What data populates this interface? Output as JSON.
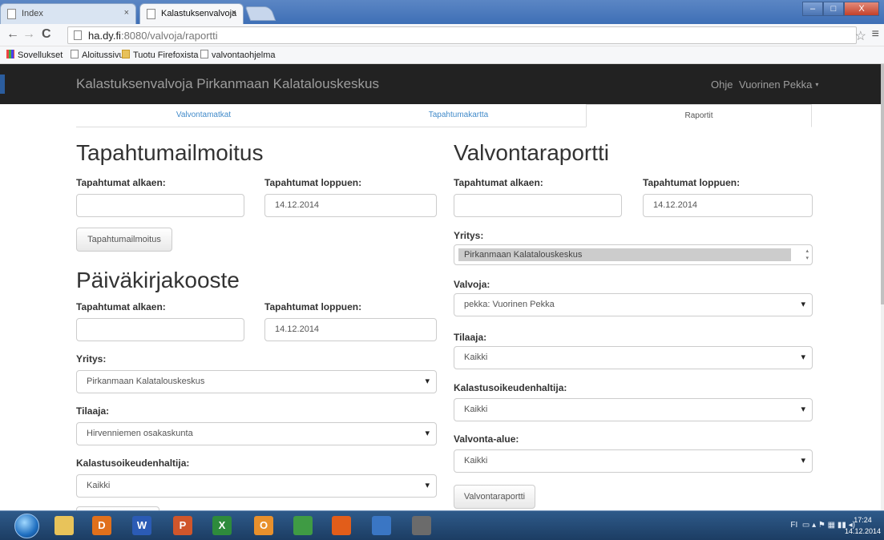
{
  "browser": {
    "tabs": [
      {
        "label": "Index",
        "close": "×"
      },
      {
        "label": "Kalastuksenvalvoja",
        "close": "×"
      }
    ],
    "window_buttons": {
      "minimize": "–",
      "maximize": "□",
      "close": "X"
    },
    "back": "←",
    "forward": "→",
    "reload": "C",
    "url_host": "ha.dy.fi",
    "url_path": ":8080/valvoja/raportti",
    "bookmark_star": "☆",
    "menu": "≡",
    "bookmarks": [
      "Sovellukset",
      "Aloitussivu",
      "Tuotu Firefoxista",
      "valvontaohjelma"
    ]
  },
  "app": {
    "brand": "Kalastuksenvalvoja   Pirkanmaan Kalatalouskeskus",
    "help": "Ohje",
    "user": "Vuorinen Pekka",
    "user_caret": "▾",
    "tabs": [
      "Valvontamatkat",
      "Tapahtumakartta",
      "Raportit"
    ],
    "active_tab": "Raportit"
  },
  "tapahtumailmoitus": {
    "title": "Tapahtumailmoitus",
    "start_label": "Tapahtumat alkaen:",
    "start_value": "",
    "end_label": "Tapahtumat loppuen:",
    "end_value": "14.12.2014",
    "button": "Tapahtumailmoitus"
  },
  "paivakirjakooste": {
    "title": "Päiväkirjakooste",
    "start_label": "Tapahtumat alkaen:",
    "start_value": "",
    "end_label": "Tapahtumat loppuen:",
    "end_value": "14.12.2014",
    "company_label": "Yritys:",
    "company_value": "Pirkanmaan Kalatalouskeskus",
    "orderer_label": "Tilaaja:",
    "orderer_value": "Hirvenniemen osakaskunta",
    "rights_label": "Kalastusoikeudenhaltija:",
    "rights_value": "Kaikki"
  },
  "valvontaraportti": {
    "title": "Valvontaraportti",
    "start_label": "Tapahtumat alkaen:",
    "start_value": "",
    "end_label": "Tapahtumat loppuen:",
    "end_value": "14.12.2014",
    "company_label": "Yritys:",
    "company_value": "Pirkanmaan Kalatalouskeskus",
    "inspector_label": "Valvoja:",
    "inspector_value": "pekka: Vuorinen Pekka",
    "orderer_label": "Tilaaja:",
    "orderer_value": "Kaikki",
    "rights_label": "Kalastusoikeudenhaltija:",
    "rights_value": "Kaikki",
    "area_label": "Valvonta-alue:",
    "area_value": "Kaikki",
    "button": "Valvontaraportti"
  },
  "taskbar": {
    "apps": [
      {
        "icon": "file-explorer-icon",
        "glyph": "",
        "color": "#e8c35a"
      },
      {
        "icon": "media-player-icon",
        "glyph": "D",
        "color": "#e0701c"
      },
      {
        "icon": "word-icon",
        "glyph": "W",
        "color": "#2b5bb5"
      },
      {
        "icon": "powerpoint-icon",
        "glyph": "P",
        "color": "#d0562b"
      },
      {
        "icon": "excel-icon",
        "glyph": "X",
        "color": "#2e8b3c"
      },
      {
        "icon": "outlook-icon",
        "glyph": "O",
        "color": "#e8902c"
      },
      {
        "icon": "chrome-icon",
        "glyph": "",
        "color": "#3f9b44"
      },
      {
        "icon": "firefox-icon",
        "glyph": "",
        "color": "#e25d1a"
      },
      {
        "icon": "security-shield-icon",
        "glyph": "",
        "color": "#3a76c4"
      },
      {
        "icon": "phone-app-icon",
        "glyph": "",
        "color": "#6b6b6b"
      }
    ],
    "language": "FI",
    "time": "17:24",
    "date": "14.12.2014"
  }
}
